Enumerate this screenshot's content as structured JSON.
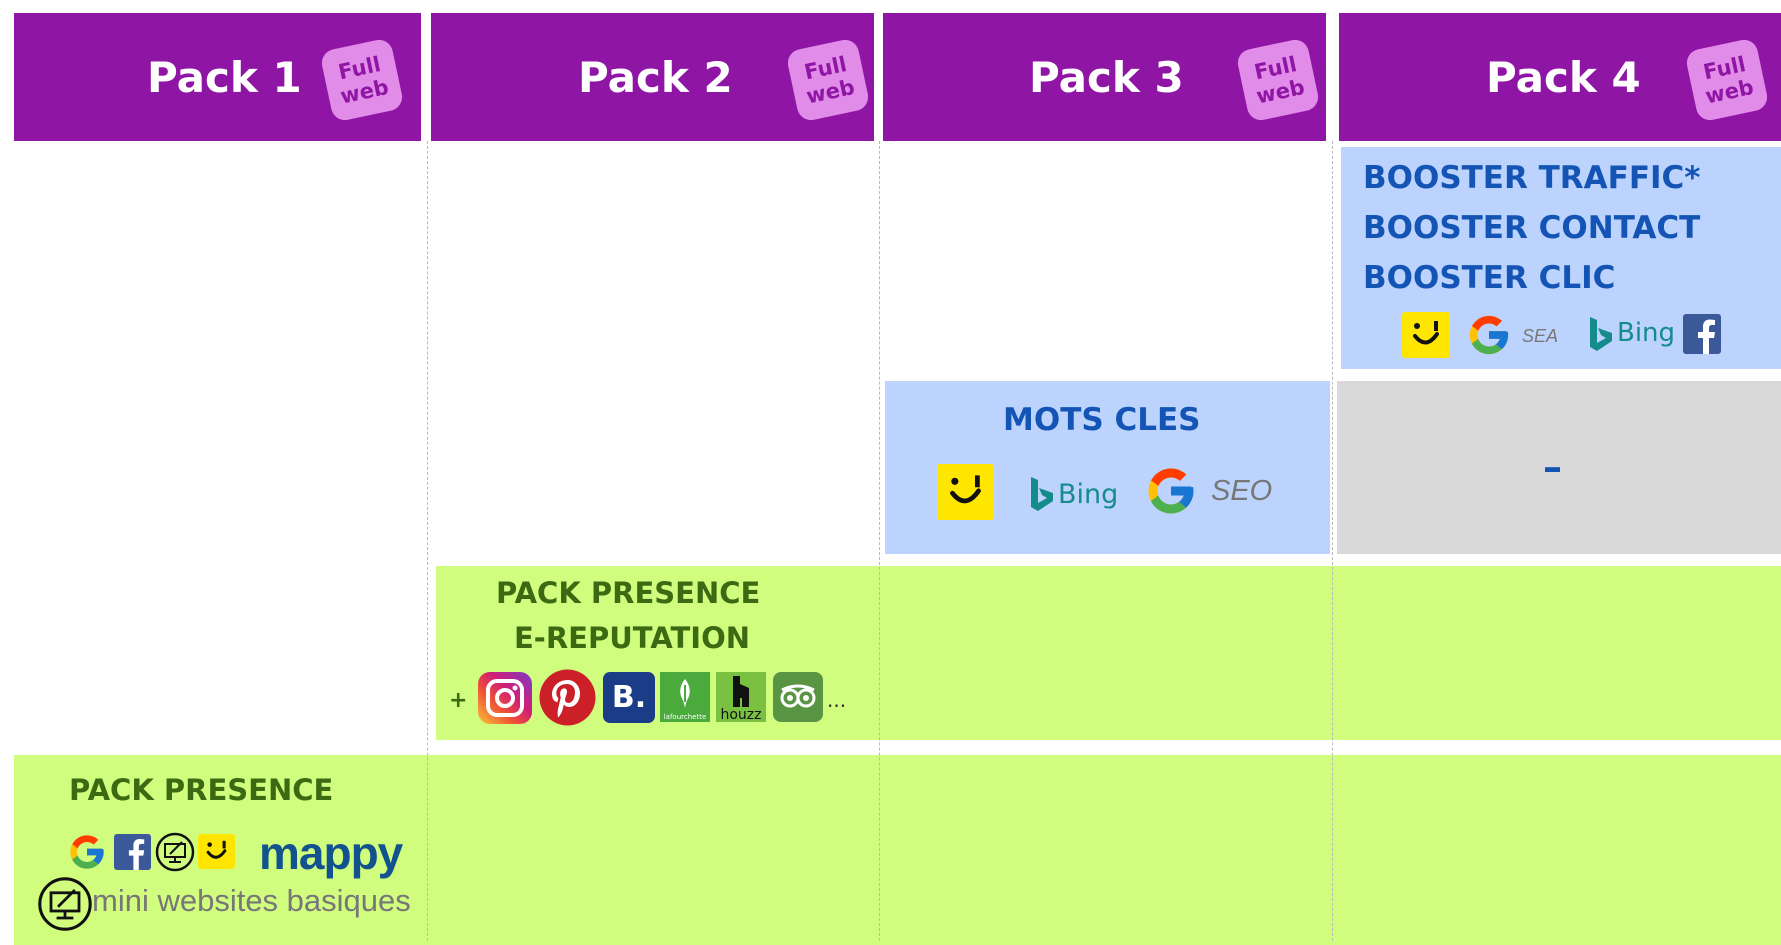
{
  "packs": [
    {
      "title": "Pack 1",
      "badge_line1": "Full",
      "badge_line2": "web"
    },
    {
      "title": "Pack 2",
      "badge_line1": "Full",
      "badge_line2": "web"
    },
    {
      "title": "Pack 3",
      "badge_line1": "Full",
      "badge_line2": "web"
    },
    {
      "title": "Pack 4",
      "badge_line1": "Full",
      "badge_line2": "web"
    }
  ],
  "booster": {
    "items": [
      "BOOSTER TRAFFIC*",
      "BOOSTER CONTACT",
      "BOOSTER CLIC"
    ],
    "sea_label": "SEA",
    "bing_label": "Bing"
  },
  "mots_cles": {
    "title": "MOTS CLES",
    "bing_label": "Bing",
    "seo_label": "SEO"
  },
  "pack4_dash": "–",
  "pack_presence_ereputation": {
    "line1": "PACK PRESENCE",
    "line2": "E-REPUTATION",
    "plus": "+",
    "ellipsis": "...",
    "houzz_label": "houzz",
    "fourchette_label": "lafourchette",
    "booking_label": "B."
  },
  "pack_presence": {
    "title": "PACK PRESENCE",
    "mappy_label": "mappy",
    "mini_sites": "mini websites basiques"
  },
  "colors": {
    "header": "#8f16a4",
    "badge": "#e28ce9",
    "green": "#d1fd7f",
    "blue": "#bcd3fd",
    "grey": "#d9d9d9",
    "booster_text": "#1454b5",
    "green_text": "#3c6a12"
  },
  "icons": [
    "pagesjaunes-icon",
    "google-icon",
    "bing-icon",
    "facebook-icon",
    "instagram-icon",
    "pinterest-icon",
    "booking-icon",
    "lafourchette-icon",
    "houzz-icon",
    "tripadvisor-icon",
    "mini-website-icon",
    "mappy-logo"
  ]
}
